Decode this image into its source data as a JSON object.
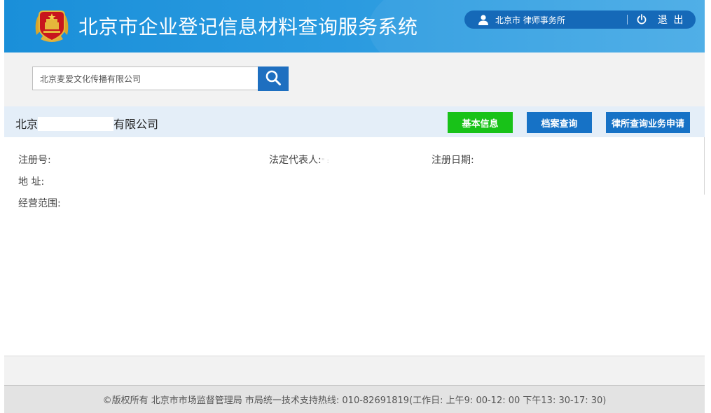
{
  "header": {
    "app_title": "北京市企业登记信息材料查询服务系统",
    "user_name": "北京市    律师事务所",
    "logout_label": "退 出"
  },
  "search": {
    "value": "北京麦爱文化传播有限公司",
    "placeholder": ""
  },
  "company": {
    "name_prefix": "北京",
    "name_suffix": "有限公司",
    "buttons": {
      "basic_info": "基本信息",
      "archive_query": "档案查询",
      "lawfirm_apply": "律所查询业务申请"
    }
  },
  "info": {
    "reg_no_label": "注册号:",
    "legal_rep_label": "法定代表人:",
    "legal_rep_value": "\" :",
    "reg_date_label": "注册日期:",
    "address_label": "地 址:",
    "scope_label": "经营范围:"
  },
  "footer": {
    "text": "©版权所有 北京市市场监督管理局  市局统一技术支持热线: 010-82691819(工作日: 上午9: 00-12: 00 下午13: 30-17: 30)"
  },
  "colors": {
    "header_blue": "#2b9be0",
    "button_green": "#18c218",
    "button_blue": "#1672c6",
    "search_button": "#1e6fc0"
  }
}
